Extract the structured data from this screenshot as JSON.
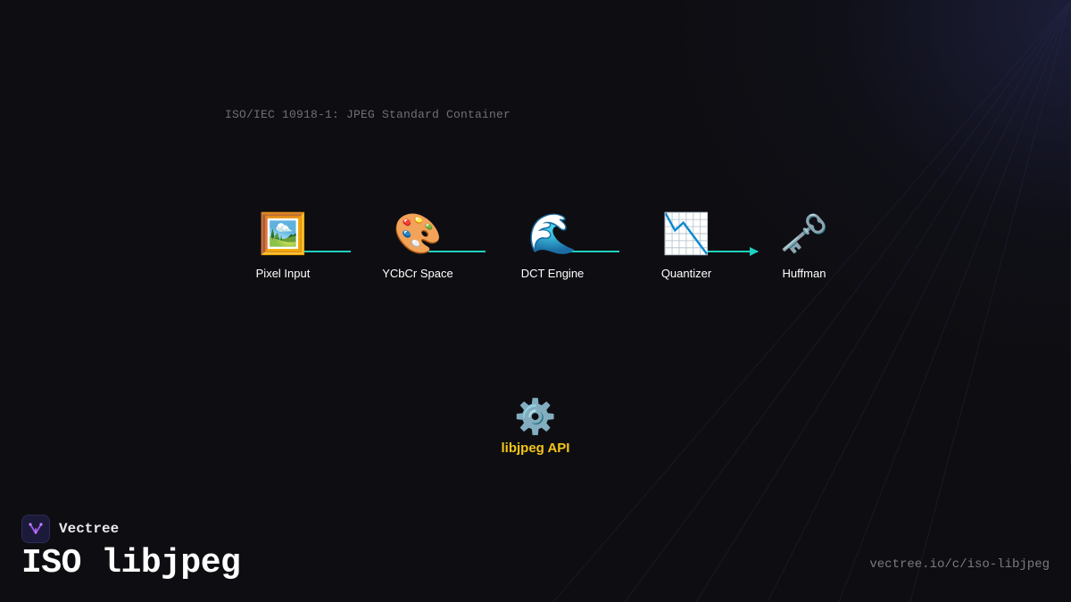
{
  "container": {
    "label": "ISO/IEC 10918-1: JPEG Standard Container"
  },
  "pipeline": {
    "connector_color": "#1fd1c0",
    "nodes": [
      {
        "label": "Pixel Input",
        "icon": "framed-picture-icon",
        "glyph": "🖼️"
      },
      {
        "label": "YCbCr Space",
        "icon": "palette-icon",
        "glyph": "🎨"
      },
      {
        "label": "DCT Engine",
        "icon": "water-wave-icon",
        "glyph": "🌊"
      },
      {
        "label": "Quantizer",
        "icon": "chart-decreasing-icon",
        "glyph": "📉"
      },
      {
        "label": "Huffman",
        "icon": "old-key-icon",
        "glyph": "🗝️"
      }
    ]
  },
  "api": {
    "label": "libjpeg API",
    "icon": "gear-icon",
    "glyph": "⚙️",
    "color": "#f5c518"
  },
  "brand": {
    "name": "Vectree",
    "icon": "vectree-logo-icon"
  },
  "page": {
    "title": "ISO libjpeg",
    "url": "vectree.io/c/iso-libjpeg"
  }
}
